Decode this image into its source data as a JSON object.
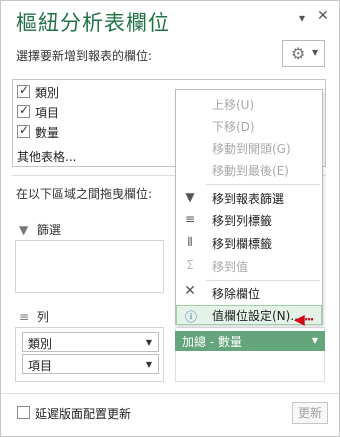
{
  "pane": {
    "title": "樞紐分析表欄位",
    "subtitle": "選擇要新增到報表的欄位:"
  },
  "fields": [
    {
      "label": "類別",
      "checked": true
    },
    {
      "label": "項目",
      "checked": true
    },
    {
      "label": "數量",
      "checked": true
    }
  ],
  "more_tables": "其他表格...",
  "drag_hint": "在以下區域之間拖曳欄位:",
  "areas": {
    "filters": {
      "label": "篩選"
    },
    "rows": {
      "label": "列",
      "items": [
        "類別",
        "項目"
      ]
    },
    "values": {
      "label": "加總 - 數量"
    }
  },
  "context_menu": [
    {
      "label": "上移(U)",
      "icon": "",
      "disabled": true
    },
    {
      "label": "下移(D)",
      "icon": "",
      "disabled": true
    },
    {
      "label": "移動到開頭(G)",
      "icon": "",
      "disabled": true
    },
    {
      "label": "移動到最後(E)",
      "icon": "",
      "disabled": true
    },
    {
      "label": "移到報表篩選",
      "icon": "filter-icon",
      "disabled": false
    },
    {
      "label": "移到列標籤",
      "icon": "rows-icon",
      "disabled": false
    },
    {
      "label": "移到欄標籤",
      "icon": "columns-icon",
      "disabled": false
    },
    {
      "label": "移到值",
      "icon": "sigma-icon",
      "disabled": true
    },
    {
      "label": "移除欄位",
      "icon": "remove-icon",
      "disabled": false
    },
    {
      "label": "值欄位設定(N)...",
      "icon": "field-settings-icon",
      "disabled": false,
      "active": true
    }
  ],
  "footer": {
    "defer_label": "延遲版面配置更新",
    "update_button": "更新"
  },
  "colors": {
    "title": "#217346",
    "value_bar": "#64a57b",
    "highlight": "#e5f2e7",
    "indicator": "#d10a15"
  }
}
